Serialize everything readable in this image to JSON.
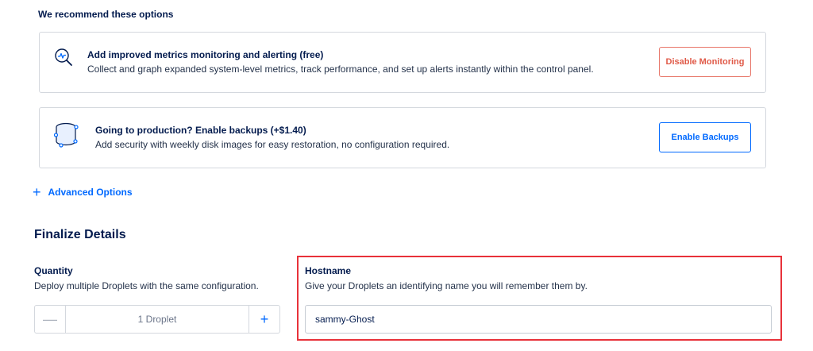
{
  "recommend": {
    "title": "We recommend these options"
  },
  "monitoring": {
    "icon": "monitoring-chart-icon",
    "heading": "Add improved metrics monitoring and alerting (free)",
    "description": "Collect and graph expanded system-level metrics, track performance, and set up alerts instantly within the control panel.",
    "button_label": "Disable Monitoring",
    "button_color": "#e05a48"
  },
  "backups": {
    "icon": "backup-disks-icon",
    "heading": "Going to production? Enable backups (+$1.40)",
    "description": "Add security with weekly disk images for easy restoration, no configuration required.",
    "button_label": "Enable Backups",
    "button_color": "#0069ff"
  },
  "advanced": {
    "label": "Advanced Options"
  },
  "finalize": {
    "title": "Finalize Details"
  },
  "quantity": {
    "label": "Quantity",
    "description": "Deploy multiple Droplets with the same configuration.",
    "value": "1 Droplet",
    "minus": "—",
    "plus": "+"
  },
  "hostname": {
    "label": "Hostname",
    "description": "Give your Droplets an identifying name you will remember them by.",
    "value": "sammy-Ghost",
    "highlight_color": "#e8323a"
  }
}
